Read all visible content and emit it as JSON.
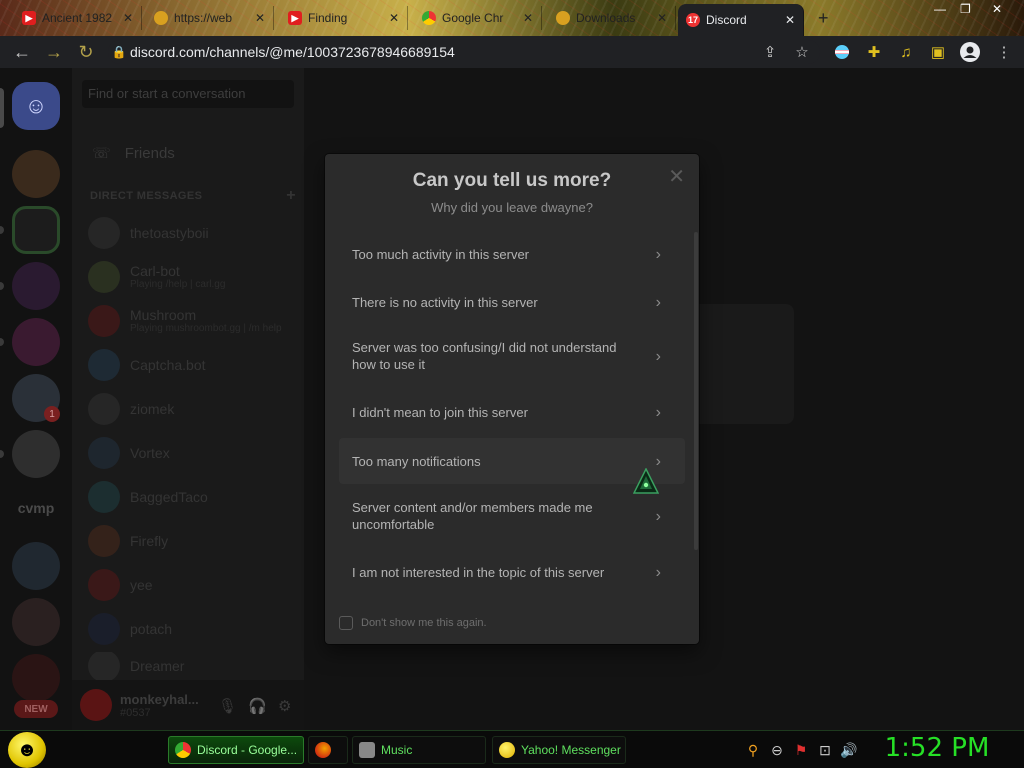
{
  "browser": {
    "tabs": [
      {
        "label": "Ancient 1982",
        "icon": "youtube-icon"
      },
      {
        "label": "https://web",
        "icon": "web-icon"
      },
      {
        "label": "Finding",
        "icon": "youtube-icon"
      },
      {
        "label": "Google Chr",
        "icon": "chrome-icon"
      },
      {
        "label": "Downloads",
        "icon": "downloads-icon"
      },
      {
        "label": "Discord",
        "icon": "discord-icon",
        "badge": "17",
        "active": true
      }
    ],
    "new_tab_glyph": "+",
    "url": "discord.com/channels/@me/1003723678946689154"
  },
  "discord": {
    "search_placeholder": "Find or start a conversation",
    "friends_label": "Friends",
    "direct_messages_header": "DIRECT MESSAGES",
    "add_dm_glyph": "+",
    "guild_text": "cvmp",
    "guild_badge": "1",
    "new_label": "NEW",
    "dms": [
      {
        "name": "thetoastyboii",
        "status": ""
      },
      {
        "name": "Carl-bot",
        "status": "Playing /help | carl.gg"
      },
      {
        "name": "Mushroom",
        "status": "Playing mushroombot.gg | /m help"
      },
      {
        "name": "Captcha.bot",
        "status": ""
      },
      {
        "name": "ziomek",
        "status": ""
      },
      {
        "name": "Vortex",
        "status": ""
      },
      {
        "name": "BaggedTaco",
        "status": ""
      },
      {
        "name": "Firefly",
        "status": ""
      },
      {
        "name": "yee",
        "status": ""
      },
      {
        "name": "potach",
        "status": ""
      },
      {
        "name": "Dreamer",
        "status": ""
      }
    ],
    "user": {
      "name": "monkeyhal...",
      "tag": "#0537"
    }
  },
  "modal": {
    "title": "Can you tell us more?",
    "subtitle": "Why did you leave dwayne?",
    "close_glyph": "✕",
    "reasons": [
      "Too much activity in this server",
      "There is no activity in this server",
      "Server was too confusing/I did not understand how to use it",
      "I didn't mean to join this server",
      "Too many notifications",
      "Server content and/or members made me uncomfortable",
      "I am not interested in the topic of this server"
    ],
    "chevron_glyph": "›",
    "dont_show_label": "Don't show me this again."
  },
  "taskbar": {
    "tasks": [
      {
        "label": "Discord - Google...",
        "icon": "chrome-icon",
        "active": true
      },
      {
        "label": "",
        "icon": "firefox-icon"
      },
      {
        "label": "Music",
        "icon": "music-icon"
      },
      {
        "label": "Yahoo! Messenger",
        "icon": "yahoo-messenger-icon"
      }
    ],
    "clock": "1:52 PM"
  },
  "colors": {
    "modal_bg": "#2b2b2b",
    "clock_green": "#26e026",
    "taskbar_active": "#0c4a0c"
  }
}
